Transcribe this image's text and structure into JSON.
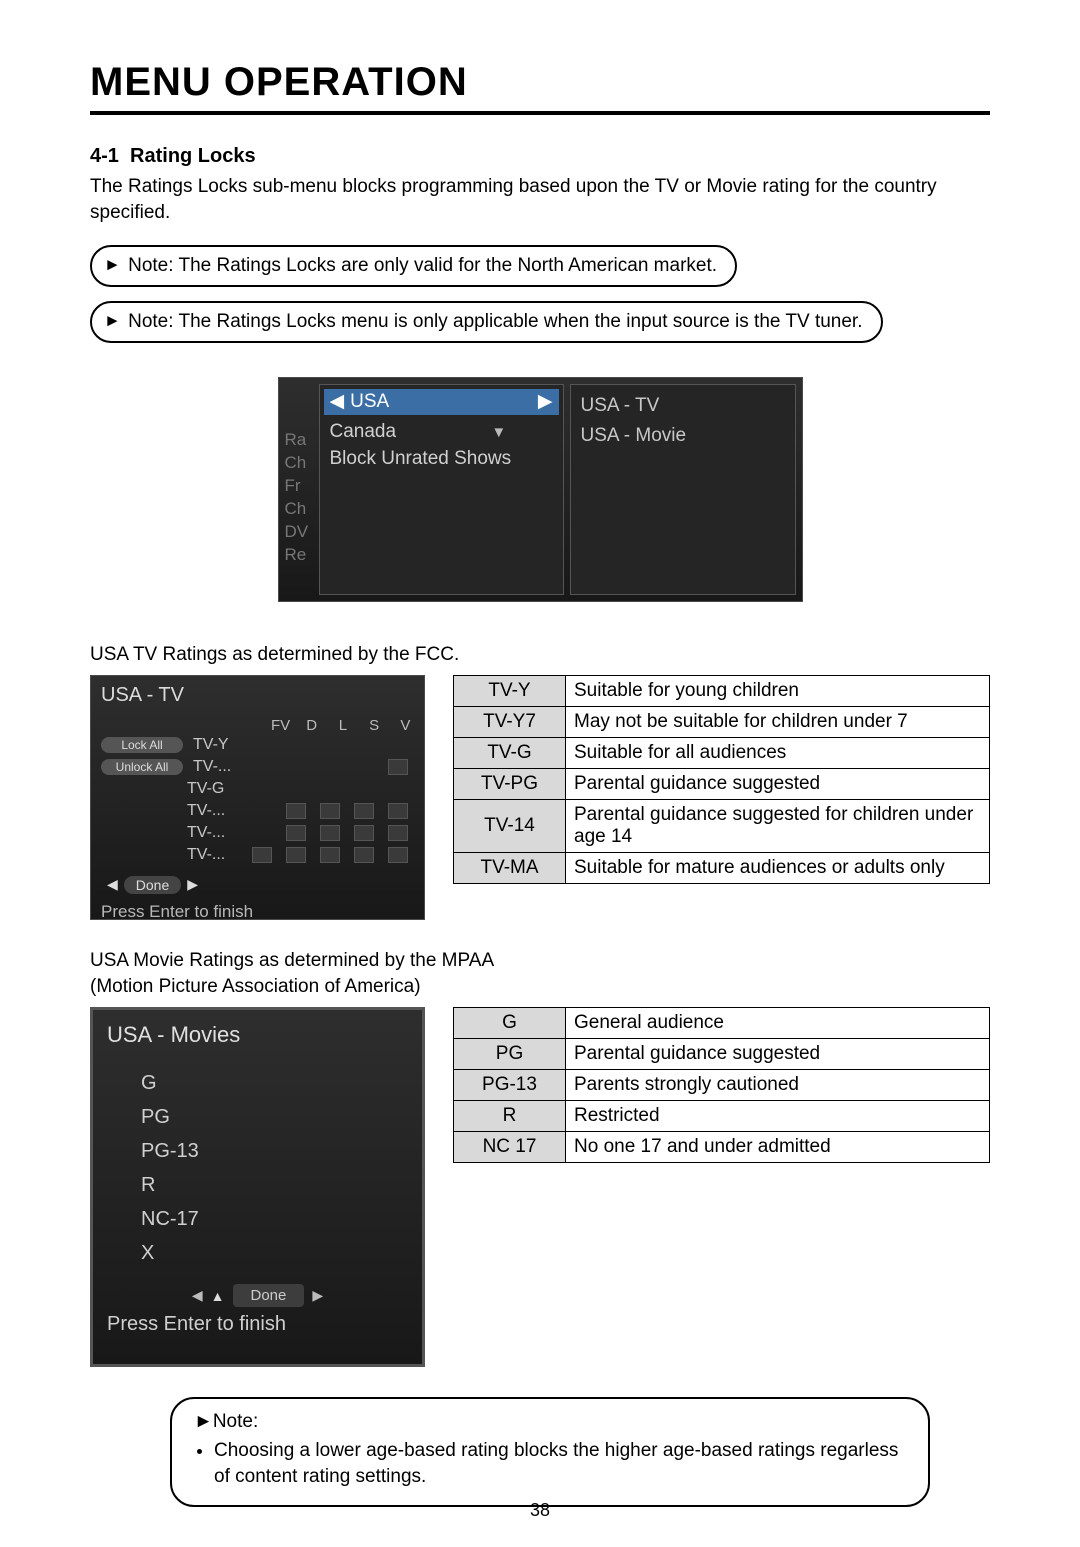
{
  "page_title": "MENU OPERATION",
  "section_number": "4-1",
  "section_title": "Rating Locks",
  "intro_text": "The Ratings Locks sub-menu blocks programming based upon the TV or Movie rating for the country specified.",
  "note1": "Note: The Ratings Locks are only valid for the North American market.",
  "note2": "Note: The Ratings Locks menu is only applicable when the input source is the TV tuner.",
  "osd1": {
    "side_letters": [
      "Ra",
      "Ch",
      "Fr",
      "Ch",
      "DV",
      "Re"
    ],
    "selected": "USA",
    "items": [
      "Canada",
      "Block Unrated Shows"
    ],
    "right_items": [
      "USA - TV",
      "USA - Movie"
    ]
  },
  "tv_caption": "USA TV Ratings as determined by the FCC.",
  "osd2": {
    "header": "USA - TV",
    "cols": [
      "FV",
      "D",
      "L",
      "S",
      "V"
    ],
    "rows": [
      {
        "pill": "Lock All",
        "label": "TV-Y",
        "boxes": 0
      },
      {
        "pill": "Unlock All",
        "label": "TV-...",
        "boxes": 1
      },
      {
        "pill": "",
        "label": "TV-G",
        "boxes": 0
      },
      {
        "pill": "",
        "label": "TV-...",
        "boxes": 4
      },
      {
        "pill": "",
        "label": "TV-...",
        "boxes": 4
      },
      {
        "pill": "",
        "label": "TV-...",
        "boxes": 5
      }
    ],
    "done_label": "Done",
    "finish": "Press Enter to finish"
  },
  "tv_table": [
    {
      "k": "TV-Y",
      "v": "Suitable for young children"
    },
    {
      "k": "TV-Y7",
      "v": "May not be suitable for children under 7"
    },
    {
      "k": "TV-G",
      "v": "Suitable for all audiences"
    },
    {
      "k": "TV-PG",
      "v": "Parental guidance suggested"
    },
    {
      "k": "TV-14",
      "v": "Parental guidance suggested for children under age 14"
    },
    {
      "k": "TV-MA",
      "v": "Suitable for mature audiences or adults only"
    }
  ],
  "movie_caption_l1": "USA Movie Ratings as determined by the MPAA",
  "movie_caption_l2": "(Motion Picture Association of America)",
  "osd3": {
    "header": "USA - Movies",
    "options": [
      "G",
      "PG",
      "PG-13",
      "R",
      "NC-17",
      "X"
    ],
    "done_label": "Done",
    "finish": "Press Enter to finish"
  },
  "movie_table": [
    {
      "k": "G",
      "v": "General audience"
    },
    {
      "k": "PG",
      "v": "Parental guidance suggested"
    },
    {
      "k": "PG-13",
      "v": "Parents strongly cautioned"
    },
    {
      "k": "R",
      "v": "Restricted"
    },
    {
      "k": "NC 17",
      "v": "No one 17 and under admitted"
    }
  ],
  "footer_note_title": "Note:",
  "footer_note_body": "Choosing a lower age-based rating blocks the higher age-based ratings regarless of content rating settings.",
  "page_number": "38",
  "glyph_play": "►"
}
